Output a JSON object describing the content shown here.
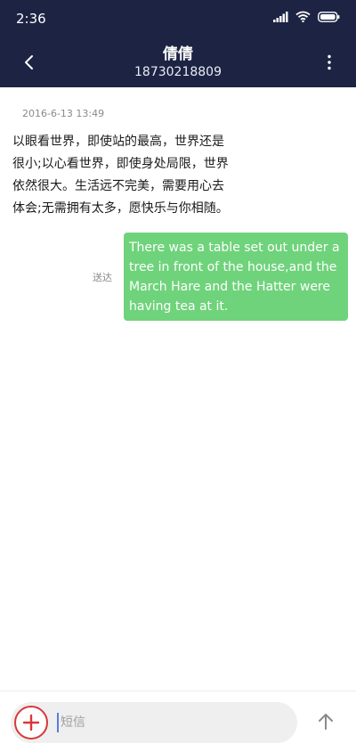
{
  "status_bar": {
    "time": "2:36"
  },
  "nav": {
    "contact_name": "倩倩",
    "contact_number": "18730218809"
  },
  "conversation": {
    "timestamp": "2016-6-13 13:49",
    "incoming_message": "以眼看世界，即使站的最高，世界还是很小;以心看世界，即使身处局限，世界依然很大。生活远不完美，需要用心去体会;无需拥有太多，愿快乐与你相随。",
    "delivered_label": "送达",
    "outgoing_message": "There was a table set out under a tree in front of the house,and the March Hare and the Hatter were having tea at it."
  },
  "composer": {
    "placeholder": "短信"
  },
  "colors": {
    "header_bg": "#1d2443",
    "outgoing_bubble": "#6fd37b",
    "add_button": "#d9383a"
  },
  "icons": {
    "back": "chevron-left-icon",
    "more": "more-vertical-icon",
    "add": "plus-icon",
    "send": "arrow-up-icon"
  }
}
